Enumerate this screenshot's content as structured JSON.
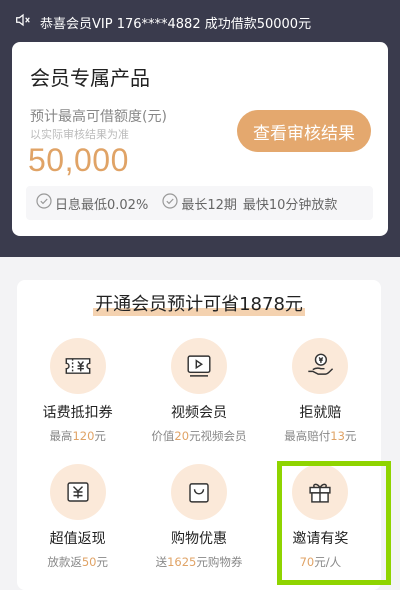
{
  "notice": {
    "text": "恭喜会员VIP 176****4882 成功借款50000元",
    "icon": "speaker-icon"
  },
  "product": {
    "title": "会员专属产品",
    "limit_label": "预计最高可借额度(元)",
    "limit_note": "以实际审核结果为准",
    "amount": "50,000",
    "button_label": "查看审核结果",
    "features": [
      {
        "text": "日息最低0.02%",
        "icon": "check-circle-icon"
      },
      {
        "text": "最长12期",
        "icon": "check-circle-icon"
      },
      {
        "text": "最快10分钟放款",
        "icon": ""
      }
    ]
  },
  "benefits": {
    "headline": "开通会员预计可省1878元",
    "items": [
      {
        "name": "话费抵扣券",
        "desc_pre": "最高",
        "desc_hl": "120",
        "desc_post": "元",
        "icon": "ticket-icon"
      },
      {
        "name": "视频会员",
        "desc_pre": "价值",
        "desc_hl": "20",
        "desc_post": "元视频会员",
        "icon": "video-play-icon"
      },
      {
        "name": "拒就赔",
        "desc_pre": "最高赔付",
        "desc_hl": "13",
        "desc_post": "元",
        "icon": "coin-hand-icon"
      },
      {
        "name": "超值返现",
        "desc_pre": "放款返",
        "desc_hl": "50",
        "desc_post": "元",
        "icon": "cash-card-icon"
      },
      {
        "name": "购物优惠",
        "desc_pre": "送",
        "desc_hl": "1625",
        "desc_post": "元购物券",
        "icon": "shopping-bag-icon"
      },
      {
        "name": "邀请有奖",
        "desc_pre": "",
        "desc_hl": "70",
        "desc_post": "元/人",
        "icon": "gift-icon"
      }
    ]
  },
  "colors": {
    "header_bg": "#3a3b4d",
    "accent": "#e4a86e",
    "highlight_border": "#8fd400"
  }
}
